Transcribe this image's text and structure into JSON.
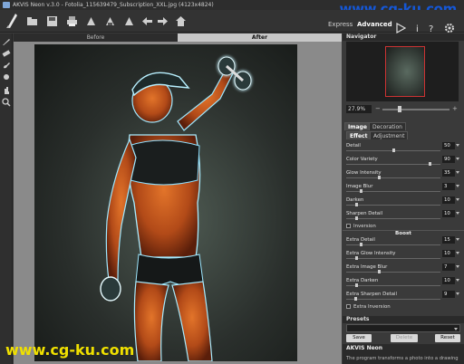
{
  "window": {
    "title": "AKVIS Neon v.3.0 - Fotolia_115639479_Subscription_XXL.jpg (4123x4824)"
  },
  "watermarks": {
    "top": "www.cg-ku.com",
    "bottom": "www.cg-ku.com"
  },
  "toolbar": {
    "modes": [
      "Express",
      "Advanced"
    ],
    "active_mode": "Advanced",
    "icons": [
      "open-icon",
      "save-icon",
      "print-icon",
      "share-icon",
      "batch-icon",
      "plugin-icon",
      "undo-icon",
      "redo-icon",
      "home-icon",
      "run-icon",
      "about-icon",
      "help-icon",
      "settings-icon"
    ]
  },
  "canvas": {
    "tabs": [
      "Before",
      "After"
    ],
    "active_tab": "After"
  },
  "navigator": {
    "title": "Navigator",
    "zoom": "27.9%",
    "zoom_minus": "−",
    "zoom_plus": "+"
  },
  "settings_tabs": [
    "Image",
    "Decoration"
  ],
  "settings_subtabs": [
    "Effect",
    "Adjustment"
  ],
  "params": [
    {
      "label": "Detail",
      "value": "50",
      "fraction": 0.5
    },
    {
      "label": "Color Variety",
      "value": "90",
      "fraction": 0.9
    },
    {
      "label": "Glow Intensity",
      "value": "35",
      "fraction": 0.35
    },
    {
      "label": "Image Blur",
      "value": "3",
      "fraction": 0.15
    },
    {
      "label": "Darken",
      "value": "10",
      "fraction": 0.1
    },
    {
      "label": "Sharpen Detail",
      "value": "10",
      "fraction": 0.1
    }
  ],
  "inversion_label": "Inversion",
  "boost": {
    "title": "Boost",
    "params": [
      {
        "label": "Extra Detail",
        "value": "15",
        "fraction": 0.15
      },
      {
        "label": "Extra Glow Intensity",
        "value": "10",
        "fraction": 0.1
      },
      {
        "label": "Extra Image Blur",
        "value": "7",
        "fraction": 0.35
      },
      {
        "label": "Extra Darken",
        "value": "10",
        "fraction": 0.1
      },
      {
        "label": "Extra Sharpen Detail",
        "value": "9",
        "fraction": 0.09
      }
    ],
    "inversion_label": "Extra Inversion"
  },
  "presets": {
    "title": "Presets",
    "save": "Save",
    "delete": "Delete",
    "reset": "Reset"
  },
  "about": {
    "title": "AKVIS Neon",
    "description": "The program transforms a photo into a drawing"
  }
}
